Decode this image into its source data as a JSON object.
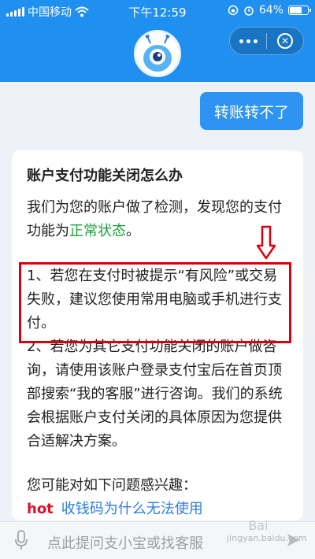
{
  "status_bar": {
    "carrier": "中国移动",
    "time": "下午12:59",
    "battery": "64%",
    "battery_level_percent": 64
  },
  "header": {
    "avatar_icon": "robot-mascot-icon",
    "more_icon": "more-dots-icon",
    "close_icon": "close-circle-icon"
  },
  "chat": {
    "user_message": "转账转不了",
    "answer": {
      "title": "账户支付功能关闭怎么办",
      "intro_before": "我们为您的账户做了检测，发现您的支付功能为",
      "intro_status": "正常状态",
      "intro_after": "。",
      "item1": "1、若您在支付时被提示“有风险”或交易失败，建议您使用常用电脑或手机进行支付。",
      "item2": "2、若您为其它支付功能关闭的账户做咨询，请使用该账户登录支付宝后在首页顶部搜索“我的客服”进行咨询。我们的系统会根据账户支付关闭的具体原因为您提供合适解决方案。",
      "interest_label": "您可能对如下问题感兴趣：",
      "hot_badge": "hot",
      "hot_link": "收钱码为什么无法使用"
    }
  },
  "input_bar": {
    "placeholder": "点此提问支小宝或找客服",
    "mic_icon": "microphone-icon",
    "send_icon": "send-arrow-icon"
  },
  "watermark": {
    "line1": "Bai",
    "line2": "jingyan.baidu.com"
  },
  "colors": {
    "header_blue": "#1f8ff0",
    "bubble_blue": "#2d94f3",
    "status_green": "#1aa33a",
    "annotation_red": "#d8000f"
  }
}
